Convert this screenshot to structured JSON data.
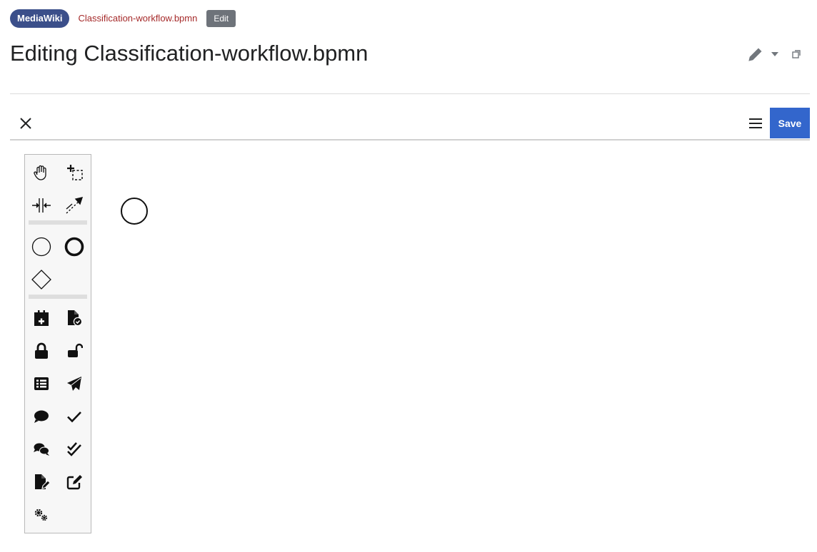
{
  "breadcrumb": {
    "site_badge": "MediaWiki",
    "page_link": "Classification-workflow.bpmn",
    "mode_badge": "Edit"
  },
  "page_title": "Editing Classification-workflow.bpmn",
  "title_tools": [
    "pencil-icon",
    "dropdown-caret-icon",
    "popout-icon"
  ],
  "editor_toolbar": {
    "close_icon": "close-icon",
    "menu_icon": "hamburger-menu-icon",
    "save_label": "Save"
  },
  "palette": {
    "groups": [
      [
        "hand-tool-icon",
        "lasso-tool-icon",
        "space-tool-icon",
        "global-connect-icon"
      ],
      [
        "start-event-icon",
        "end-event-icon",
        "gateway-icon"
      ],
      [
        "calendar-plus-icon",
        "file-check-icon",
        "lock-icon",
        "unlock-icon",
        "list-icon",
        "paper-plane-icon",
        "comment-icon",
        "check-icon",
        "comments-icon",
        "check-double-icon",
        "file-edit-icon",
        "edit-square-icon",
        "cogs-icon"
      ]
    ]
  },
  "canvas": {
    "elements": [
      "start-event"
    ]
  },
  "colors": {
    "brand": "#3b4f8a",
    "save": "#3366cc",
    "link": "#a52a2a"
  }
}
